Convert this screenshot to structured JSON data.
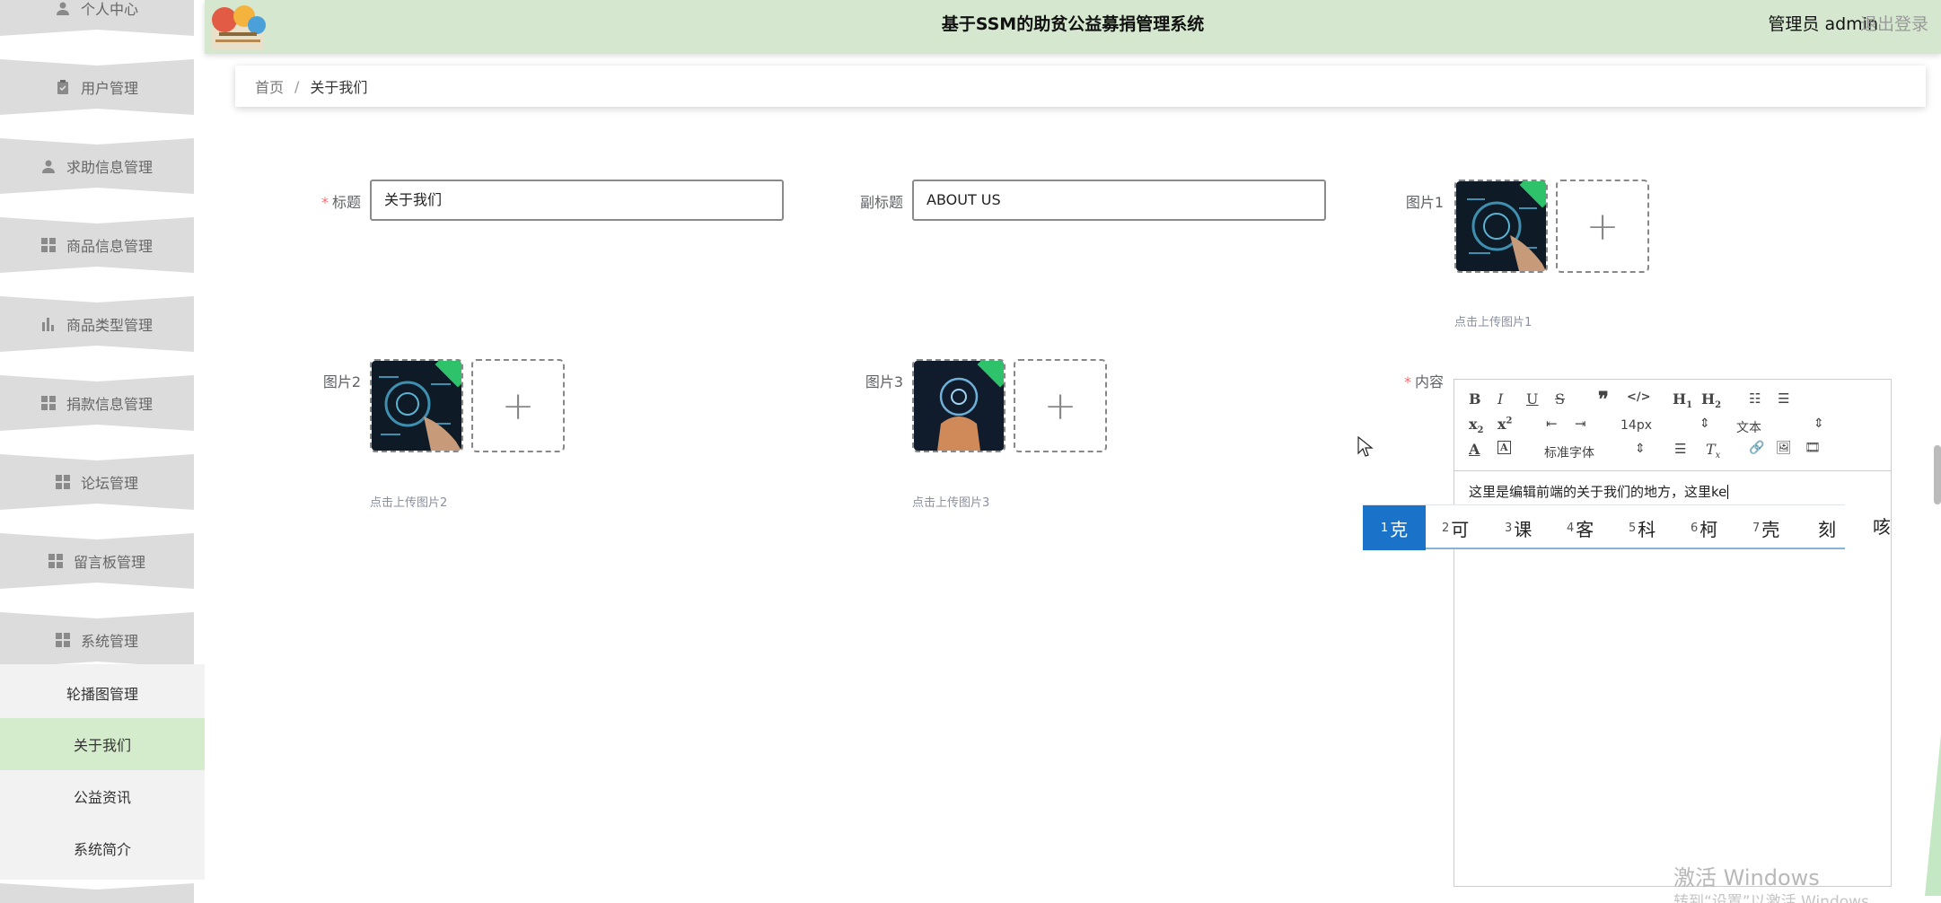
{
  "header": {
    "title": "基于SSM的助贫公益募捐管理系统",
    "user": "管理员 admin",
    "logout": "退出登录"
  },
  "sidebar": {
    "items": [
      {
        "label": "个人中心",
        "icon": "user-icon"
      },
      {
        "label": "用户管理",
        "icon": "clipboard-icon"
      },
      {
        "label": "求助信息管理",
        "icon": "user-icon"
      },
      {
        "label": "商品信息管理",
        "icon": "grid-icon"
      },
      {
        "label": "商品类型管理",
        "icon": "bar-chart-icon"
      },
      {
        "label": "捐款信息管理",
        "icon": "grid-icon"
      },
      {
        "label": "论坛管理",
        "icon": "grid-icon"
      },
      {
        "label": "留言板管理",
        "icon": "grid-icon"
      },
      {
        "label": "系统管理",
        "icon": "grid-icon"
      }
    ],
    "subitems": [
      "轮播图管理",
      "关于我们",
      "公益资讯",
      "系统简介"
    ],
    "active_subitem": "关于我们",
    "active_color": "#d4eccb"
  },
  "breadcrumb": {
    "home": "首页",
    "sep": "/",
    "current": "关于我们"
  },
  "form": {
    "title_label": "标题",
    "title_value": "关于我们",
    "subtitle_label": "副标题",
    "subtitle_value": "ABOUT US",
    "pic1_label": "图片1",
    "pic1_hint": "点击上传图片1",
    "pic2_label": "图片2",
    "pic2_hint": "点击上传图片2",
    "pic3_label": "图片3",
    "pic3_hint": "点击上传图片3",
    "content_label": "内容",
    "required_mark": "*",
    "plus": "+"
  },
  "editor": {
    "font_size": "14px",
    "block_type": "文本",
    "font_family": "标准字体",
    "text": "这里是编辑前端的关于我们的地方，这里ke",
    "toolbar_icons": [
      "bold-icon",
      "italic-icon",
      "underline-icon",
      "strike-icon",
      "quote-icon",
      "code-icon",
      "h1-icon",
      "h2-icon",
      "ordered-list-icon",
      "bullet-list-icon",
      "subscript-icon",
      "superscript-icon",
      "outdent-icon",
      "indent-icon",
      "font-color-icon",
      "background-color-icon",
      "align-icon",
      "clear-format-icon",
      "link-icon",
      "image-icon",
      "video-icon"
    ]
  },
  "ime": {
    "candidates": [
      {
        "num": "1",
        "text": "克"
      },
      {
        "num": "2",
        "text": "可"
      },
      {
        "num": "3",
        "text": "课"
      },
      {
        "num": "4",
        "text": "客"
      },
      {
        "num": "5",
        "text": "科"
      },
      {
        "num": "6",
        "text": "柯"
      },
      {
        "num": "7",
        "text": "壳"
      },
      {
        "num": "",
        "text": "刻"
      }
    ],
    "extra": "咳"
  },
  "watermark": {
    "line1": "激活 Windows",
    "line2": "转到“设置”以激活 Windows"
  }
}
